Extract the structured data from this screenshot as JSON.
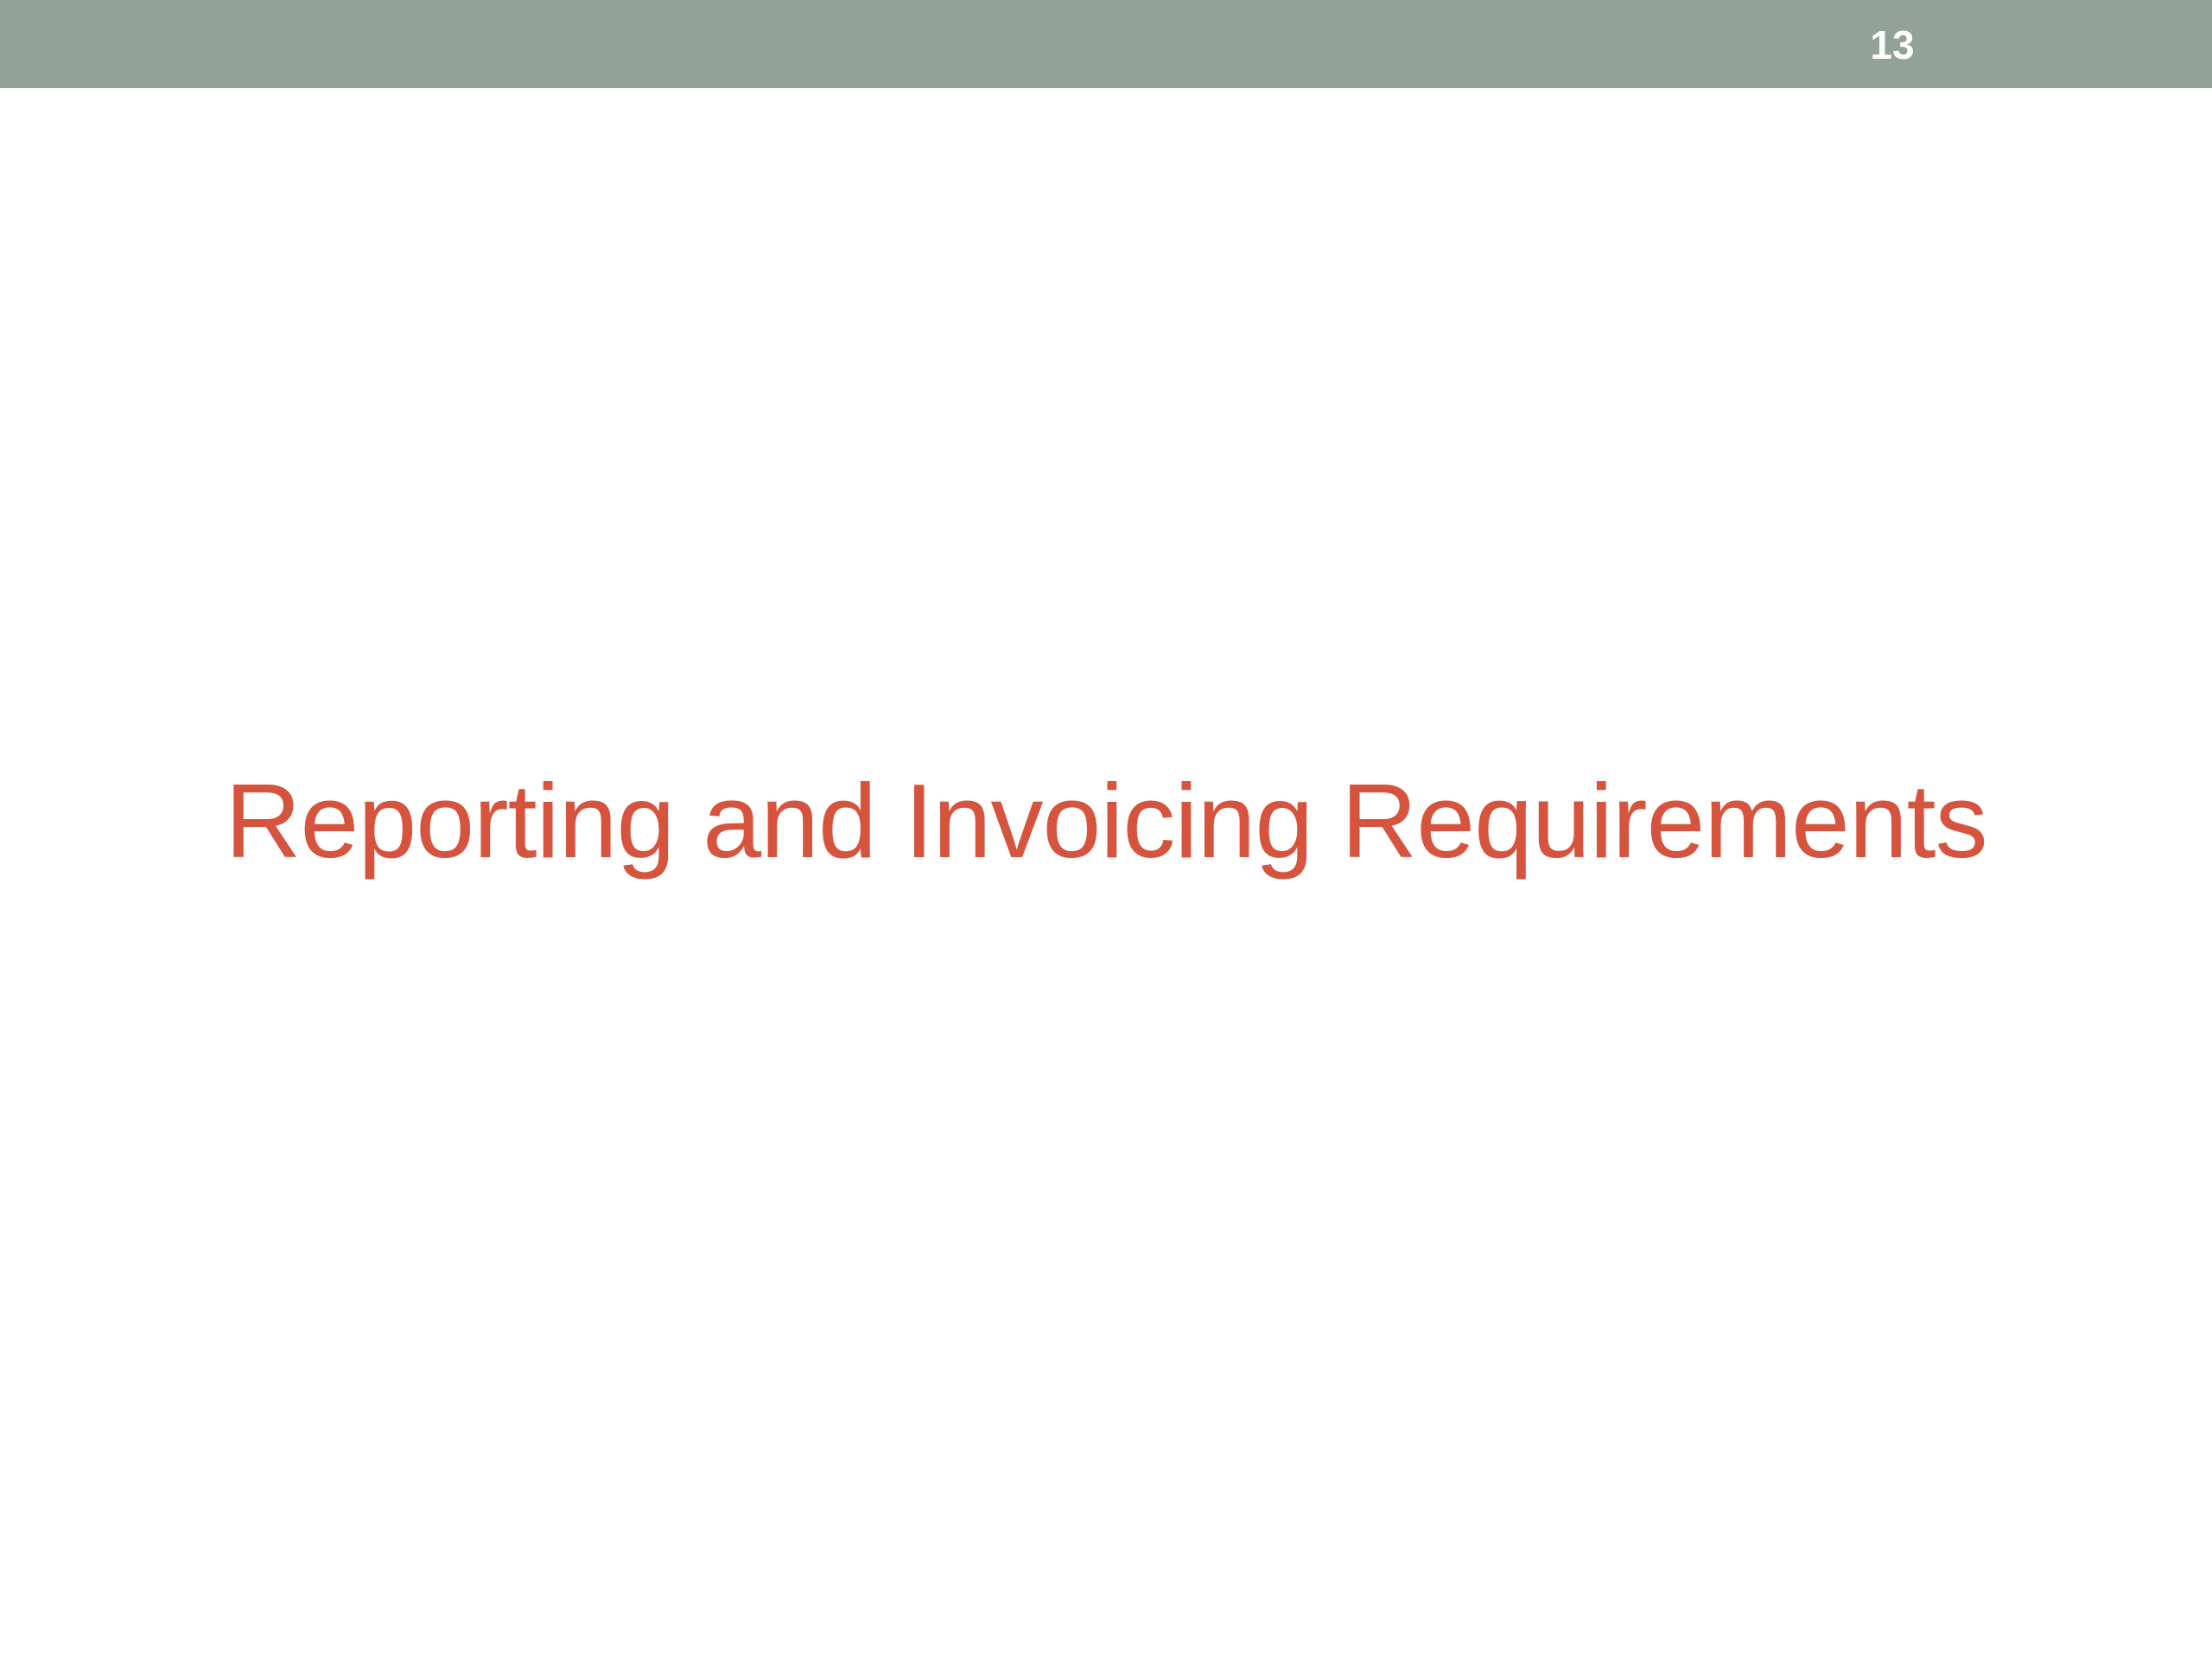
{
  "slide": {
    "number": "13",
    "title": "Reporting and Invoicing Requirements"
  },
  "colors": {
    "band": "#93a299",
    "title": "#d6533e",
    "number": "#ffffff",
    "background": "#ffffff"
  }
}
